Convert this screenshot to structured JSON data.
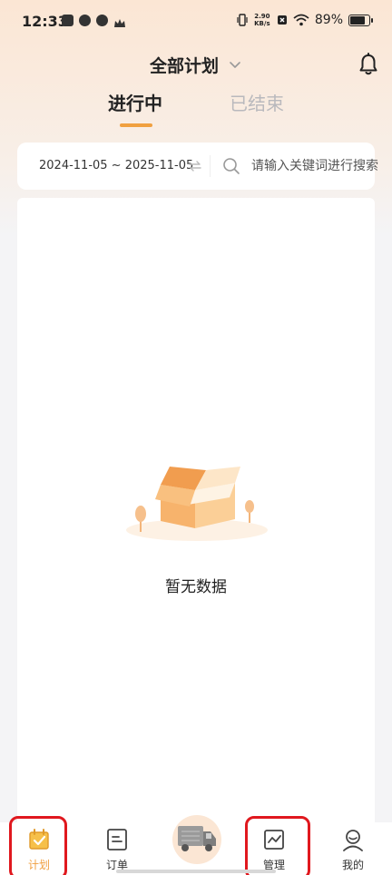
{
  "status_bar": {
    "time": "12:33",
    "net_speed_value": "2.90",
    "net_speed_unit": "KB/s",
    "battery_percent": "89%"
  },
  "header": {
    "plan_selector_label": "全部计划",
    "icons": {
      "dropdown": "chevron-down-icon",
      "notification": "bell-icon"
    }
  },
  "tabs": [
    {
      "label": "进行中",
      "active": true
    },
    {
      "label": "已结束",
      "active": false
    }
  ],
  "filter": {
    "date_range": "2024-11-05 ~ 2025-11-05",
    "search_placeholder": "请输入关键词进行搜索"
  },
  "empty_state": {
    "message": "暂无数据"
  },
  "bottom_nav": {
    "items": [
      {
        "label": "计划",
        "icon": "calendar-check-icon",
        "active": true
      },
      {
        "label": "订单",
        "icon": "document-icon",
        "active": false
      },
      {
        "label": "",
        "icon": "truck-icon",
        "active": false
      },
      {
        "label": "管理",
        "icon": "chart-icon",
        "active": false
      },
      {
        "label": "我的",
        "icon": "user-icon",
        "active": false
      }
    ]
  },
  "colors": {
    "accent": "#f0a040",
    "highlight_box": "#e0181e",
    "header_gradient_top": "#fbe6d4",
    "background": "#f4f4f6"
  }
}
